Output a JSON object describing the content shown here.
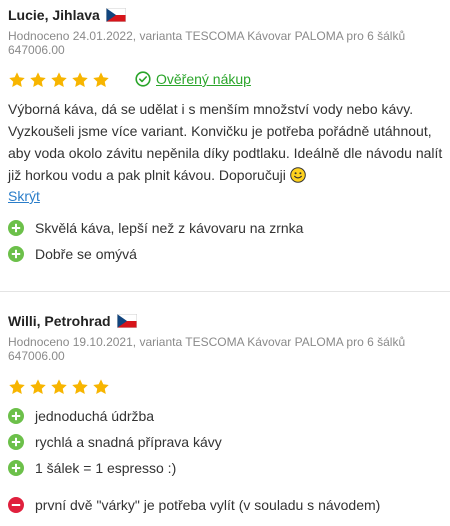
{
  "colors": {
    "star": "#f7b500",
    "verified": "#2aa52a",
    "link": "#2a7dc9",
    "pro": "#6cc04a",
    "con": "#e0203d"
  },
  "reviews": [
    {
      "author": "Lucie, Jihlava",
      "flag_icon": "czech-flag-icon",
      "meta_line1": "Hodnoceno 24.01.2022, varianta TESCOMA Kávovar PALOMA pro 6 šálků",
      "meta_line2": "647006.00",
      "rating": 5,
      "verified_label": "Ověřený nákup",
      "text": "Výborná káva, dá se udělat i s menším množství vody nebo kávy. Vyzkoušeli jsme více variant. Konvičku je potřeba pořádně utáhnout, aby voda okolo závitu nepěnila díky podtlaku. Ideálně dle návodu nalít již horkou vodu a pak plnit kávou. Doporučuji",
      "hide_label": "Skrýt",
      "pros": [
        "Skvělá káva, lepší než z kávovaru na zrnka",
        "Dobře se omývá"
      ],
      "cons": []
    },
    {
      "author": "Willi, Petrohrad",
      "flag_icon": "czech-flag-icon",
      "meta_line1": "Hodnoceno 19.10.2021, varianta TESCOMA Kávovar PALOMA pro 6 šálků",
      "meta_line2": "647006.00",
      "rating": 5,
      "pros": [
        "jednoduchá údržba",
        "rychlá a snadná příprava kávy",
        "1 šálek = 1 espresso :)"
      ],
      "cons": [
        "první dvě \"várky\" je potřeba vylít (v souladu s návodem)"
      ]
    }
  ]
}
